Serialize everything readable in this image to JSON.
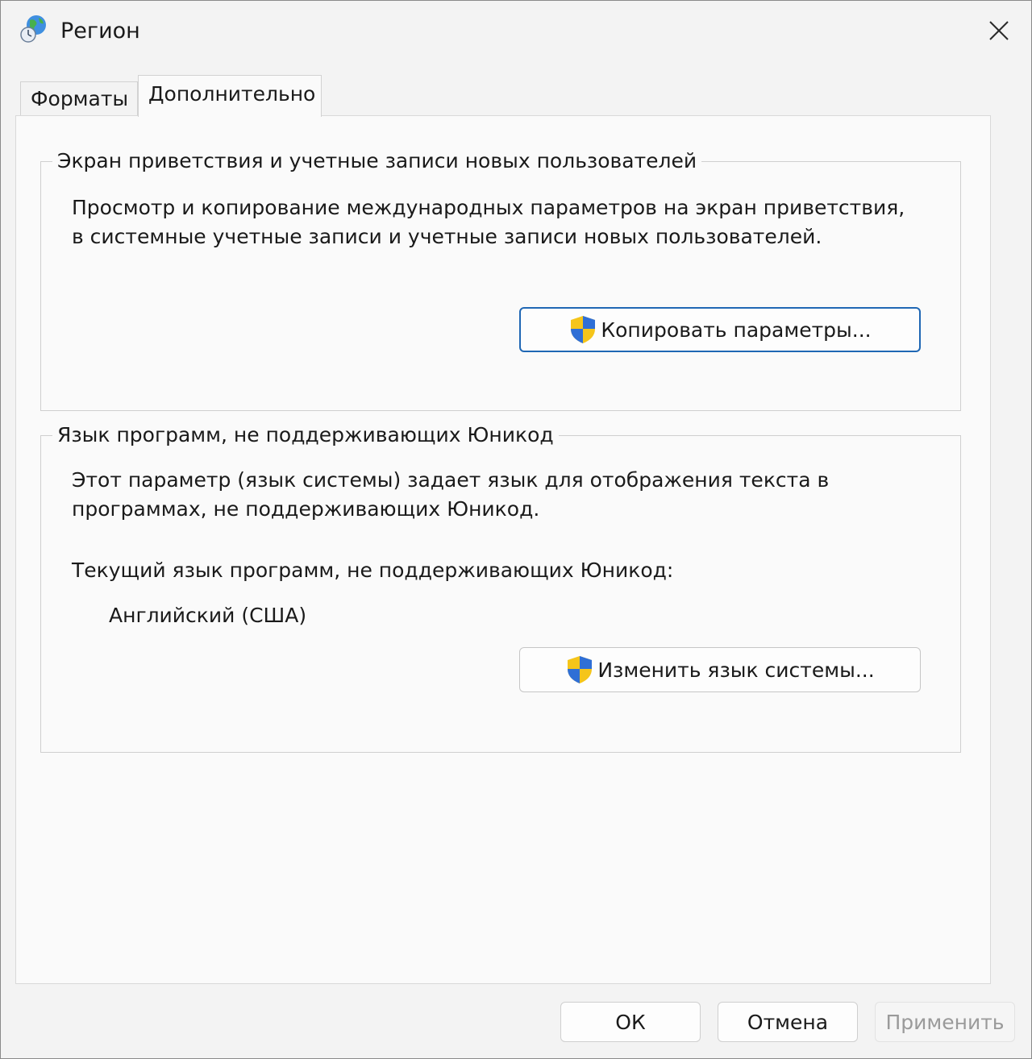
{
  "window": {
    "title": "Регион"
  },
  "tabs": [
    {
      "label": "Форматы",
      "active": false
    },
    {
      "label": "Дополнительно",
      "active": true
    }
  ],
  "welcome_group": {
    "legend": "Экран приветствия и учетные записи новых пользователей",
    "description_line1": "Просмотр и копирование международных параметров на экран приветствия,",
    "description_line2": "в системные учетные записи и учетные записи новых пользователей.",
    "copy_button_label": "Копировать параметры..."
  },
  "unicode_group": {
    "legend": "Язык программ, не поддерживающих Юникод",
    "description_line1": "Этот параметр (язык системы) задает язык для отображения текста в",
    "description_line2": "программах, не поддерживающих Юникод.",
    "current_label": "Текущий язык программ, не поддерживающих Юникод:",
    "current_value": "Английский (США)",
    "change_button_label": "Изменить язык системы..."
  },
  "footer": {
    "ok_label": "ОК",
    "cancel_label": "Отмена",
    "apply_label": "Применить",
    "apply_disabled": true
  },
  "icons": {
    "app": "globe-clock-icon",
    "close": "close-icon",
    "admin": "uac-shield-icon"
  },
  "colors": {
    "default_button_border": "#1f67b4",
    "shield_blue": "#2f6fd6",
    "shield_yellow": "#f5c51a"
  }
}
